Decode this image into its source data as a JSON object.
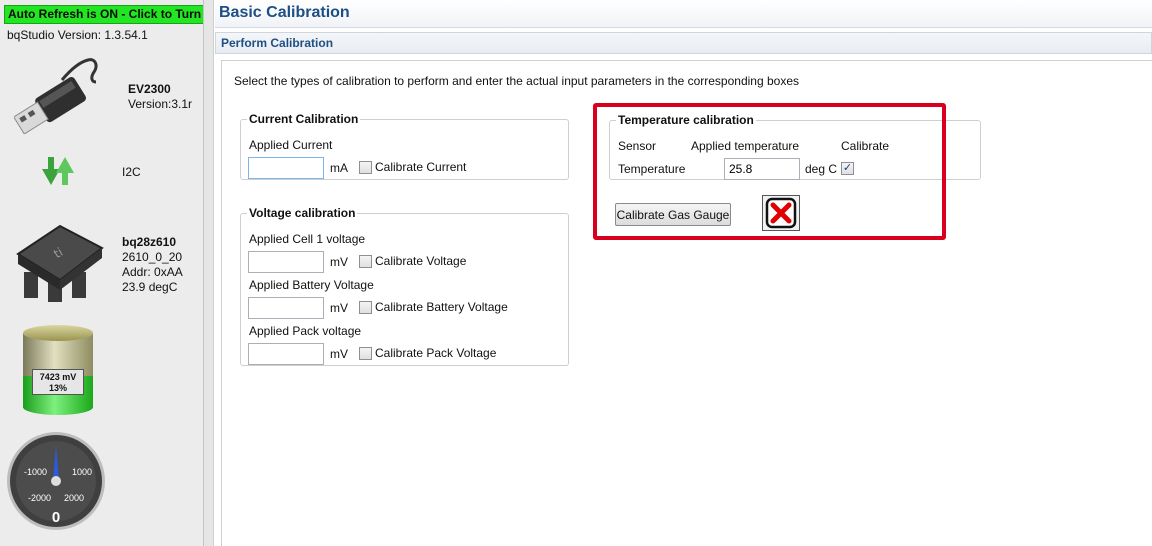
{
  "sidebar": {
    "auto_refresh": "Auto Refresh is ON - Click to Turn OFF",
    "version_label": "bqStudio Version:",
    "version_value": "1.3.54.1",
    "adapter": {
      "name": "EV2300",
      "version": "Version:3.1r"
    },
    "bus": {
      "label": "I2C"
    },
    "device": {
      "name": "bq28z610",
      "firmware": "2610_0_20",
      "address": "Addr: 0xAA",
      "temperature": "23.9 degC"
    },
    "battery": {
      "voltage": "7423 mV",
      "charge": "13%",
      "charge_fraction": 0.13
    },
    "gauge": {
      "min_left": "-2000",
      "inner_left": "-1000",
      "inner_right": "1000",
      "max_right": "2000",
      "value": "0"
    }
  },
  "main": {
    "title": "Basic Calibration",
    "section": "Perform Calibration",
    "instructions": "Select the types of calibration to perform and enter the actual input parameters in the corresponding boxes"
  },
  "current_cal": {
    "legend": "Current Calibration",
    "applied_label": "Applied Current",
    "value": "",
    "unit": "mA",
    "checkbox_label": "Calibrate Current",
    "checked": false
  },
  "voltage_cal": {
    "legend": "Voltage calibration",
    "rows": [
      {
        "label": "Applied Cell 1 voltage",
        "value": "",
        "unit": "mV",
        "checkbox_label": "Calibrate Voltage",
        "checked": false
      },
      {
        "label": "Applied Battery Voltage",
        "value": "",
        "unit": "mV",
        "checkbox_label": "Calibrate Battery Voltage",
        "checked": false
      },
      {
        "label": "Applied Pack voltage",
        "value": "",
        "unit": "mV",
        "checkbox_label": "Calibrate Pack Voltage",
        "checked": false
      }
    ]
  },
  "temp_cal": {
    "legend": "Temperature calibration",
    "col_sensor": "Sensor",
    "col_applied": "Applied temperature",
    "col_calibrate": "Calibrate",
    "row_label": "Temperature",
    "value": "25.8",
    "unit": "deg C",
    "checked": true,
    "checkmark": "✓"
  },
  "actions": {
    "calibrate_button": "Calibrate Gas Gauge",
    "status_icon": "x-status-icon"
  },
  "colors": {
    "accent": "#1d4f84",
    "auto_refresh_on": "#22e622",
    "highlight": "#d8001c",
    "status_x": "#e00000"
  }
}
